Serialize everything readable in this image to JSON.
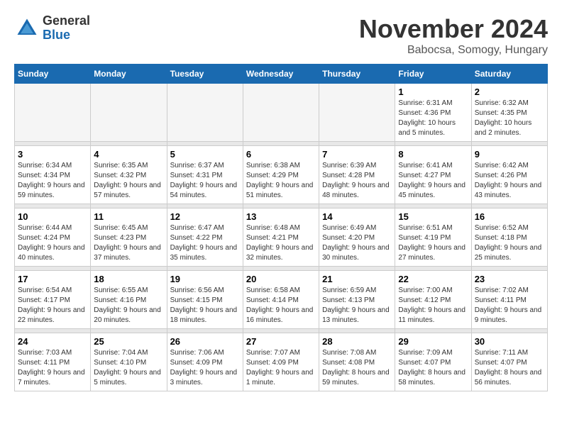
{
  "header": {
    "logo_text1": "General",
    "logo_text2": "Blue",
    "month": "November 2024",
    "location": "Babocsa, Somogy, Hungary"
  },
  "days_of_week": [
    "Sunday",
    "Monday",
    "Tuesday",
    "Wednesday",
    "Thursday",
    "Friday",
    "Saturday"
  ],
  "weeks": [
    [
      {
        "day": "",
        "empty": true
      },
      {
        "day": "",
        "empty": true
      },
      {
        "day": "",
        "empty": true
      },
      {
        "day": "",
        "empty": true
      },
      {
        "day": "",
        "empty": true
      },
      {
        "day": "1",
        "sunrise": "Sunrise: 6:31 AM",
        "sunset": "Sunset: 4:36 PM",
        "daylight": "Daylight: 10 hours and 5 minutes."
      },
      {
        "day": "2",
        "sunrise": "Sunrise: 6:32 AM",
        "sunset": "Sunset: 4:35 PM",
        "daylight": "Daylight: 10 hours and 2 minutes."
      }
    ],
    [
      {
        "day": "3",
        "sunrise": "Sunrise: 6:34 AM",
        "sunset": "Sunset: 4:34 PM",
        "daylight": "Daylight: 9 hours and 59 minutes."
      },
      {
        "day": "4",
        "sunrise": "Sunrise: 6:35 AM",
        "sunset": "Sunset: 4:32 PM",
        "daylight": "Daylight: 9 hours and 57 minutes."
      },
      {
        "day": "5",
        "sunrise": "Sunrise: 6:37 AM",
        "sunset": "Sunset: 4:31 PM",
        "daylight": "Daylight: 9 hours and 54 minutes."
      },
      {
        "day": "6",
        "sunrise": "Sunrise: 6:38 AM",
        "sunset": "Sunset: 4:29 PM",
        "daylight": "Daylight: 9 hours and 51 minutes."
      },
      {
        "day": "7",
        "sunrise": "Sunrise: 6:39 AM",
        "sunset": "Sunset: 4:28 PM",
        "daylight": "Daylight: 9 hours and 48 minutes."
      },
      {
        "day": "8",
        "sunrise": "Sunrise: 6:41 AM",
        "sunset": "Sunset: 4:27 PM",
        "daylight": "Daylight: 9 hours and 45 minutes."
      },
      {
        "day": "9",
        "sunrise": "Sunrise: 6:42 AM",
        "sunset": "Sunset: 4:26 PM",
        "daylight": "Daylight: 9 hours and 43 minutes."
      }
    ],
    [
      {
        "day": "10",
        "sunrise": "Sunrise: 6:44 AM",
        "sunset": "Sunset: 4:24 PM",
        "daylight": "Daylight: 9 hours and 40 minutes."
      },
      {
        "day": "11",
        "sunrise": "Sunrise: 6:45 AM",
        "sunset": "Sunset: 4:23 PM",
        "daylight": "Daylight: 9 hours and 37 minutes."
      },
      {
        "day": "12",
        "sunrise": "Sunrise: 6:47 AM",
        "sunset": "Sunset: 4:22 PM",
        "daylight": "Daylight: 9 hours and 35 minutes."
      },
      {
        "day": "13",
        "sunrise": "Sunrise: 6:48 AM",
        "sunset": "Sunset: 4:21 PM",
        "daylight": "Daylight: 9 hours and 32 minutes."
      },
      {
        "day": "14",
        "sunrise": "Sunrise: 6:49 AM",
        "sunset": "Sunset: 4:20 PM",
        "daylight": "Daylight: 9 hours and 30 minutes."
      },
      {
        "day": "15",
        "sunrise": "Sunrise: 6:51 AM",
        "sunset": "Sunset: 4:19 PM",
        "daylight": "Daylight: 9 hours and 27 minutes."
      },
      {
        "day": "16",
        "sunrise": "Sunrise: 6:52 AM",
        "sunset": "Sunset: 4:18 PM",
        "daylight": "Daylight: 9 hours and 25 minutes."
      }
    ],
    [
      {
        "day": "17",
        "sunrise": "Sunrise: 6:54 AM",
        "sunset": "Sunset: 4:17 PM",
        "daylight": "Daylight: 9 hours and 22 minutes."
      },
      {
        "day": "18",
        "sunrise": "Sunrise: 6:55 AM",
        "sunset": "Sunset: 4:16 PM",
        "daylight": "Daylight: 9 hours and 20 minutes."
      },
      {
        "day": "19",
        "sunrise": "Sunrise: 6:56 AM",
        "sunset": "Sunset: 4:15 PM",
        "daylight": "Daylight: 9 hours and 18 minutes."
      },
      {
        "day": "20",
        "sunrise": "Sunrise: 6:58 AM",
        "sunset": "Sunset: 4:14 PM",
        "daylight": "Daylight: 9 hours and 16 minutes."
      },
      {
        "day": "21",
        "sunrise": "Sunrise: 6:59 AM",
        "sunset": "Sunset: 4:13 PM",
        "daylight": "Daylight: 9 hours and 13 minutes."
      },
      {
        "day": "22",
        "sunrise": "Sunrise: 7:00 AM",
        "sunset": "Sunset: 4:12 PM",
        "daylight": "Daylight: 9 hours and 11 minutes."
      },
      {
        "day": "23",
        "sunrise": "Sunrise: 7:02 AM",
        "sunset": "Sunset: 4:11 PM",
        "daylight": "Daylight: 9 hours and 9 minutes."
      }
    ],
    [
      {
        "day": "24",
        "sunrise": "Sunrise: 7:03 AM",
        "sunset": "Sunset: 4:11 PM",
        "daylight": "Daylight: 9 hours and 7 minutes."
      },
      {
        "day": "25",
        "sunrise": "Sunrise: 7:04 AM",
        "sunset": "Sunset: 4:10 PM",
        "daylight": "Daylight: 9 hours and 5 minutes."
      },
      {
        "day": "26",
        "sunrise": "Sunrise: 7:06 AM",
        "sunset": "Sunset: 4:09 PM",
        "daylight": "Daylight: 9 hours and 3 minutes."
      },
      {
        "day": "27",
        "sunrise": "Sunrise: 7:07 AM",
        "sunset": "Sunset: 4:09 PM",
        "daylight": "Daylight: 9 hours and 1 minute."
      },
      {
        "day": "28",
        "sunrise": "Sunrise: 7:08 AM",
        "sunset": "Sunset: 4:08 PM",
        "daylight": "Daylight: 8 hours and 59 minutes."
      },
      {
        "day": "29",
        "sunrise": "Sunrise: 7:09 AM",
        "sunset": "Sunset: 4:07 PM",
        "daylight": "Daylight: 8 hours and 58 minutes."
      },
      {
        "day": "30",
        "sunrise": "Sunrise: 7:11 AM",
        "sunset": "Sunset: 4:07 PM",
        "daylight": "Daylight: 8 hours and 56 minutes."
      }
    ]
  ]
}
